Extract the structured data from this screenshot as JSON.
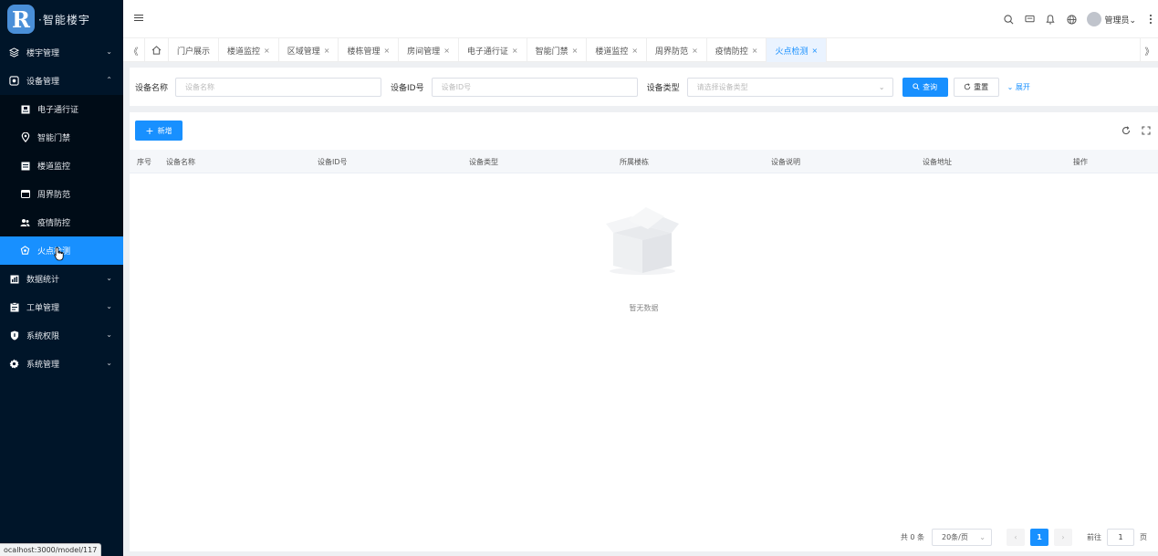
{
  "app": {
    "logo_letter": "R",
    "title": "智能楼宇"
  },
  "sidebar": {
    "items": [
      {
        "label": "楼宇管理",
        "icon": "layers-icon",
        "arrow": "⌄"
      },
      {
        "label": "设备管理",
        "icon": "device-icon",
        "arrow": "⌃"
      },
      {
        "label": "数据统计",
        "icon": "chart-icon",
        "arrow": "⌄"
      },
      {
        "label": "工单管理",
        "icon": "clipboard-icon",
        "arrow": "⌄"
      },
      {
        "label": "系统权限",
        "icon": "shield-icon",
        "arrow": "⌄"
      },
      {
        "label": "系统管理",
        "icon": "gear-icon",
        "arrow": "⌄"
      }
    ],
    "sub_items": [
      {
        "label": "电子通行证",
        "icon": "id-card-icon"
      },
      {
        "label": "智能门禁",
        "icon": "location-pin-icon"
      },
      {
        "label": "楼道监控",
        "icon": "monitor-icon"
      },
      {
        "label": "周界防范",
        "icon": "fence-icon"
      },
      {
        "label": "疫情防控",
        "icon": "people-icon"
      },
      {
        "label": "火点检测",
        "icon": "fire-detect-icon"
      }
    ],
    "active_sub": "火点检测"
  },
  "status_bar": {
    "url": "ocalhost:3000/model/117"
  },
  "header": {
    "user_name": "管理员",
    "user_caret": "⌄"
  },
  "tabs": {
    "prev": "《",
    "next": "》",
    "items": [
      {
        "label": "门户展示",
        "closable": false
      },
      {
        "label": "楼道监控",
        "closable": true
      },
      {
        "label": "区域管理",
        "closable": true
      },
      {
        "label": "楼栋管理",
        "closable": true
      },
      {
        "label": "房间管理",
        "closable": true
      },
      {
        "label": "电子通行证",
        "closable": true
      },
      {
        "label": "智能门禁",
        "closable": true
      },
      {
        "label": "楼道监控",
        "closable": true
      },
      {
        "label": "周界防范",
        "closable": true
      },
      {
        "label": "疫情防控",
        "closable": true
      },
      {
        "label": "火点检测",
        "closable": true,
        "active": true
      }
    ],
    "close_glyph": "×"
  },
  "search": {
    "device_name_label": "设备名称",
    "device_name_placeholder": "设备名称",
    "device_id_label": "设备ID号",
    "device_id_placeholder": "设备ID号",
    "device_type_label": "设备类型",
    "device_type_placeholder": "请选择设备类型",
    "query_label": "查询",
    "reset_label": "重置",
    "expand_label": "展开"
  },
  "toolbar": {
    "add_label": "新增"
  },
  "table": {
    "columns": [
      "序号",
      "设备名称",
      "设备ID号",
      "设备类型",
      "所属楼栋",
      "设备说明",
      "设备地址",
      "操作"
    ],
    "empty_text": "暂无数据"
  },
  "pagination": {
    "total_text": "共 0 条",
    "page_size": "20条/页",
    "current_page": "1",
    "goto_label": "前往",
    "goto_value": "1",
    "page_unit": "页"
  },
  "colors": {
    "primary": "#1890ff",
    "sidebar_bg": "#001529"
  }
}
